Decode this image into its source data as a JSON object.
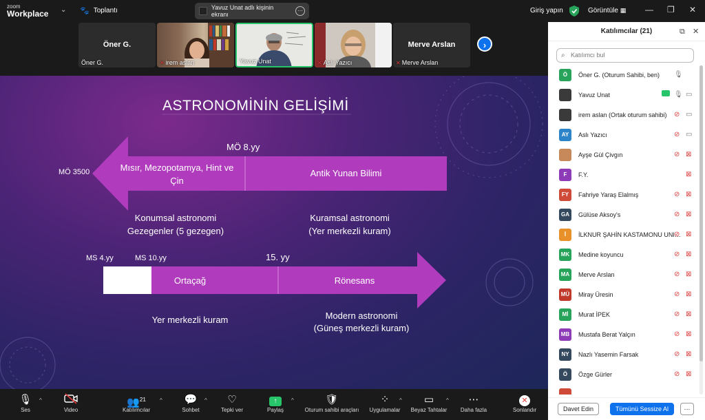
{
  "app": {
    "logo_line1": "zoom",
    "logo_line2": "Workplace"
  },
  "titlebar": {
    "meeting_label": "Toplantı",
    "share_notice": "Yavuz Unat adlı kişinin ekranı",
    "login": "Giriş yapın",
    "view": "Görüntüle",
    "minimize": "—",
    "restore": "❐",
    "close": "✕"
  },
  "videos": [
    {
      "name_big": "Öner G.",
      "label": "Öner G.",
      "muted": false
    },
    {
      "name_big": "",
      "label": "irem aslan",
      "muted": true
    },
    {
      "name_big": "",
      "label": "Yavuz Unat",
      "muted": false,
      "active": true
    },
    {
      "name_big": "",
      "label": "Aslı Yazıcı",
      "muted": true
    },
    {
      "name_big": "Merve Arslan",
      "label": "Merve Arslan",
      "muted": true
    }
  ],
  "slide": {
    "title": "ASTRONOMİNİN GELİŞİMİ",
    "mo8": "MÖ 8.yy",
    "mo3500": "MÖ 3500",
    "left_arrow_text": "Mısır, Mezopotamya, Hint ve Çin",
    "right_block_text": "Antik Yunan Bilimi",
    "konumsal1": "Konumsal astronomi",
    "konumsal2": "Gezegenler (5 gezegen)",
    "kuramsal1": "Kuramsal astronomi",
    "kuramsal2": "(Yer merkezli kuram)",
    "ms4": "MS 4.yy",
    "ms10": "MS 10.yy",
    "y15": "15. yy",
    "ortacag": "Ortaçağ",
    "ronesans": "Rönesans",
    "yer_merkezli": "Yer merkezli kuram",
    "modern1": "Modern astronomi",
    "modern2": "(Güneş merkezli kuram)"
  },
  "bottombar": {
    "ses": "Ses",
    "video": "Video",
    "katilimcilar": "Katılımcılar",
    "katilimci_count": "21",
    "sohbet": "Sohbet",
    "tepki": "Tepki ver",
    "paylas": "Paylaş",
    "oturum": "Oturum sahibi araçları",
    "uygulamalar": "Uygulamalar",
    "beyaz": "Beyaz Tahtalar",
    "daha": "Daha fazla",
    "sonlandir": "Sonlandır"
  },
  "panel": {
    "title": "Katılımcılar (21)",
    "search_placeholder": "Katılımcı bul",
    "invite": "Davet Edin",
    "mute_all": "Tümünü Sessize Al",
    "more": "···",
    "participants": [
      {
        "initials": "Ö",
        "name": "Öner G. (Oturum Sahibi, ben)",
        "color": "#27a35a",
        "mic": "on",
        "cam": "none"
      },
      {
        "initials": "",
        "name": "Yavuz Unat",
        "color": "#3a3a3a",
        "mic": "on",
        "cam": "on",
        "share": true
      },
      {
        "initials": "",
        "name": "irem aslan (Ortak oturum sahibi)",
        "color": "#3a3a3a",
        "mic": "off",
        "cam": "on"
      },
      {
        "initials": "AY",
        "name": "Aslı Yazıcı",
        "color": "#2d84c8",
        "mic": "off",
        "cam": "on"
      },
      {
        "initials": "",
        "name": "Ayşe Gül Çivgın",
        "color": "#c8895a",
        "mic": "off",
        "cam": "off"
      },
      {
        "initials": "F",
        "name": "F.Y.",
        "color": "#8e3bb8",
        "mic": "none",
        "cam": "off"
      },
      {
        "initials": "FY",
        "name": "Fahriye Yaraş Elalmış",
        "color": "#d04a3a",
        "mic": "off",
        "cam": "off"
      },
      {
        "initials": "GA",
        "name": "Gülüse Aksoy's",
        "color": "#34495e",
        "mic": "off",
        "cam": "off"
      },
      {
        "initials": "İ",
        "name": "İLKNUR ŞAHİN KASTAMONU UNIV...",
        "color": "#e8912a",
        "mic": "off",
        "cam": "off"
      },
      {
        "initials": "MK",
        "name": "Medine koyuncu",
        "color": "#27a35a",
        "mic": "off",
        "cam": "off"
      },
      {
        "initials": "MA",
        "name": "Merve Arslan",
        "color": "#27a35a",
        "mic": "off",
        "cam": "off"
      },
      {
        "initials": "MÜ",
        "name": "Miray Üresin",
        "color": "#c0392b",
        "mic": "off",
        "cam": "off"
      },
      {
        "initials": "Mİ",
        "name": "Murat İPEK",
        "color": "#27a35a",
        "mic": "off",
        "cam": "off"
      },
      {
        "initials": "MB",
        "name": "Mustafa Berat Yalçın",
        "color": "#8e3bb8",
        "mic": "off",
        "cam": "off"
      },
      {
        "initials": "NY",
        "name": "Nazlı Yasemin Farsak",
        "color": "#34495e",
        "mic": "off",
        "cam": "off"
      },
      {
        "initials": "Ö",
        "name": "Özge Gürler",
        "color": "#34495e",
        "mic": "off",
        "cam": "off"
      },
      {
        "initials": "",
        "name": "",
        "color": "#d04a3a",
        "mic": "none",
        "cam": "none"
      }
    ]
  },
  "icons": {
    "mic_off": "🎙",
    "cam_off": "📷"
  }
}
